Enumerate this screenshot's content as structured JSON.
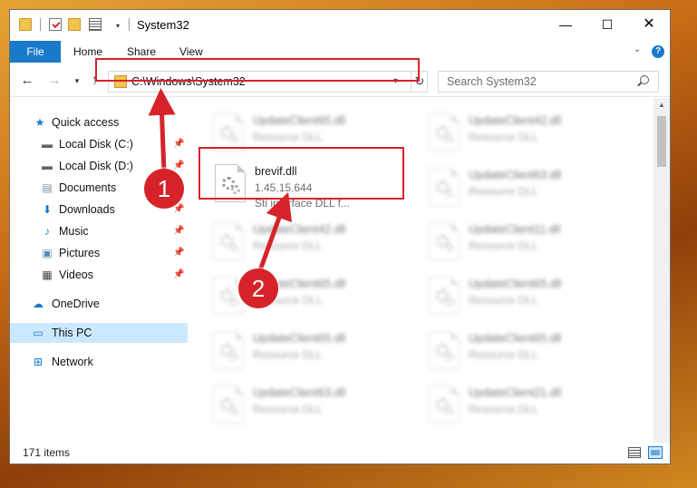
{
  "titlebar": {
    "title": "System32",
    "quick_access_dropdown": "▾",
    "minimize": "—",
    "maximize": "☐",
    "close": "✕"
  },
  "ribbon": {
    "file": "File",
    "home": "Home",
    "share": "Share",
    "view": "View",
    "help": "?"
  },
  "nav": {
    "back": "←",
    "forward": "→",
    "recent": "▾",
    "up": "↑",
    "address": "C:\\Windows\\System32",
    "address_dropdown": "▾",
    "refresh": "↻"
  },
  "search": {
    "placeholder": "Search System32"
  },
  "sidebar": {
    "items": [
      {
        "label": "Quick access",
        "icon": "star-icon"
      },
      {
        "label": "Local Disk (C:)",
        "icon": "drive-icon"
      },
      {
        "label": "Local Disk (D:)",
        "icon": "drive-icon"
      },
      {
        "label": "Documents",
        "icon": "documents-icon"
      },
      {
        "label": "Downloads",
        "icon": "download-icon"
      },
      {
        "label": "Music",
        "icon": "music-icon"
      },
      {
        "label": "Pictures",
        "icon": "pictures-icon"
      },
      {
        "label": "Videos",
        "icon": "videos-icon"
      },
      {
        "label": "OneDrive",
        "icon": "cloud-icon"
      },
      {
        "label": "This PC",
        "icon": "computer-icon"
      },
      {
        "label": "Network",
        "icon": "network-icon"
      }
    ]
  },
  "files": {
    "featured": {
      "name": "brevif.dll",
      "version": "1.45.15.644",
      "description": "Sti interface DLL f..."
    },
    "blurred": [
      {
        "name": "UpdateClient65.dll",
        "type": "Resource DLL"
      },
      {
        "name": "UpdateClient42.dll",
        "type": "Resource DLL"
      },
      {
        "name": "UpdateClient63.dll",
        "type": "Resource DLL"
      },
      {
        "name": "UpdateClient42.dll",
        "type": "Resource DLL"
      },
      {
        "name": "UpdateClient11.dll",
        "type": "Resource DLL"
      },
      {
        "name": "UpdateClient65.dll",
        "type": "Resource DLL"
      },
      {
        "name": "UpdateClient65.dll",
        "type": "Resource DLL"
      },
      {
        "name": "UpdateClient65.dll",
        "type": "Resource DLL"
      },
      {
        "name": "UpdateClient65.dll",
        "type": "Resource DLL"
      },
      {
        "name": "UpdateClient63.dll",
        "type": "Resource DLL"
      },
      {
        "name": "UpdateClient21.dll",
        "type": "Resource DLL"
      }
    ]
  },
  "status": {
    "count": "171 items"
  },
  "annotations": {
    "step1": "1",
    "step2": "2"
  },
  "colors": {
    "accent": "#1979ca",
    "highlight": "#d6232a",
    "selected": "#cce8ff"
  }
}
